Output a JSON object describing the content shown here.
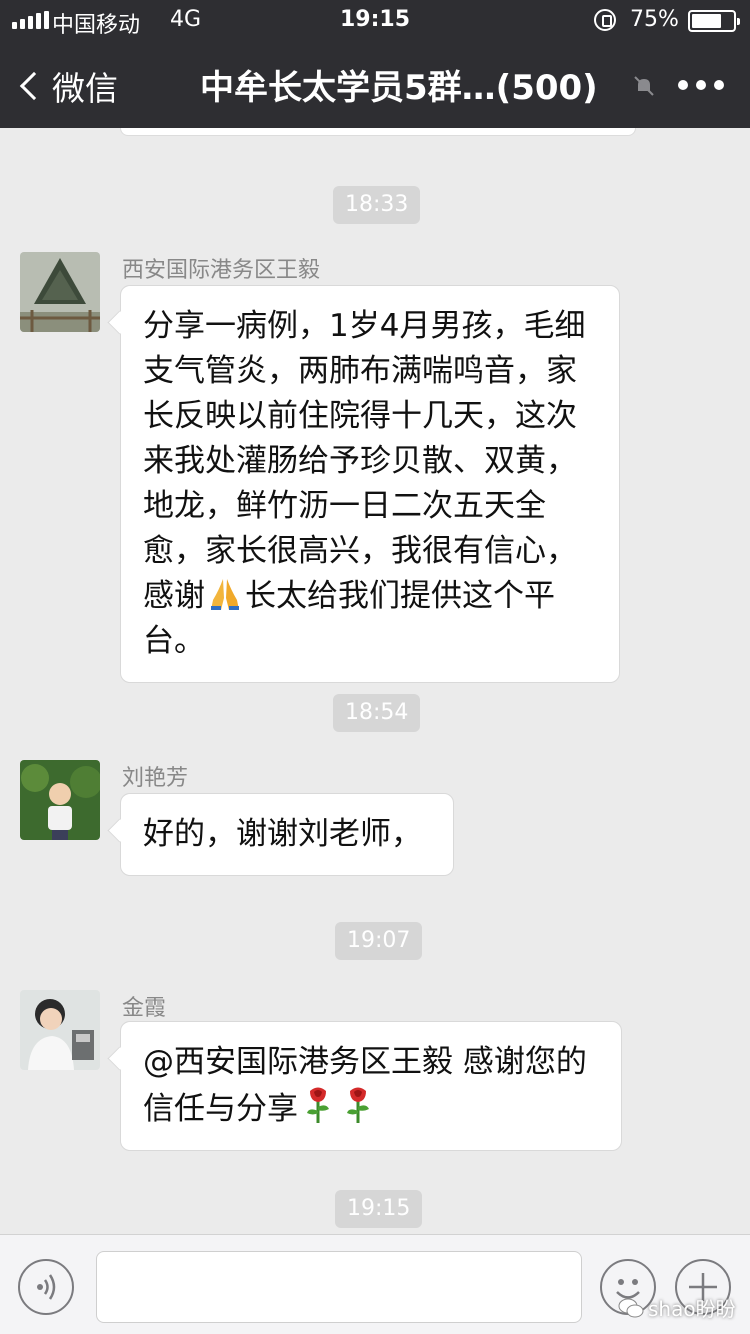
{
  "status": {
    "carrier": "中国移动",
    "network": "4G",
    "time": "19:15",
    "battery": "75%",
    "battery_level": 0.75
  },
  "nav": {
    "back_label": "微信",
    "title": "中牟长太学员5群…(500)"
  },
  "messages": [
    {
      "time": "18:33",
      "sender": "西安国际港务区王毅",
      "lines": [
        "分享一病例，1岁4月男孩，毛细",
        "支气管炎，两肺布满喘鸣音，家",
        "长反映以前住院得十几天，这次",
        "来我处灌肠给予珍贝散、双黄，",
        "地龙，鲜竹沥一日二次五天全",
        "愈，家长很高兴，我很有信心，"
      ],
      "line7_before": "感谢",
      "line7_after": "长太给我们提供这个平",
      "line8": "台。"
    },
    {
      "time": "18:54",
      "sender": "刘艳芳",
      "text": "好的，谢谢刘老师，"
    },
    {
      "time": "19:07",
      "sender": "金霞",
      "line1": "@西安国际港务区王毅 感谢您的",
      "line2": "信任与分享"
    }
  ],
  "last_time": "19:15",
  "watermark": "shao盼盼",
  "icons": {
    "back": "chevron-left-icon",
    "mute": "mute-bell-icon",
    "more": "more-dots-icon",
    "voice": "voice-icon",
    "emoji": "emoji-icon",
    "plus": "plus-icon",
    "pray": "pray-emoji",
    "rose": "rose-emoji"
  }
}
